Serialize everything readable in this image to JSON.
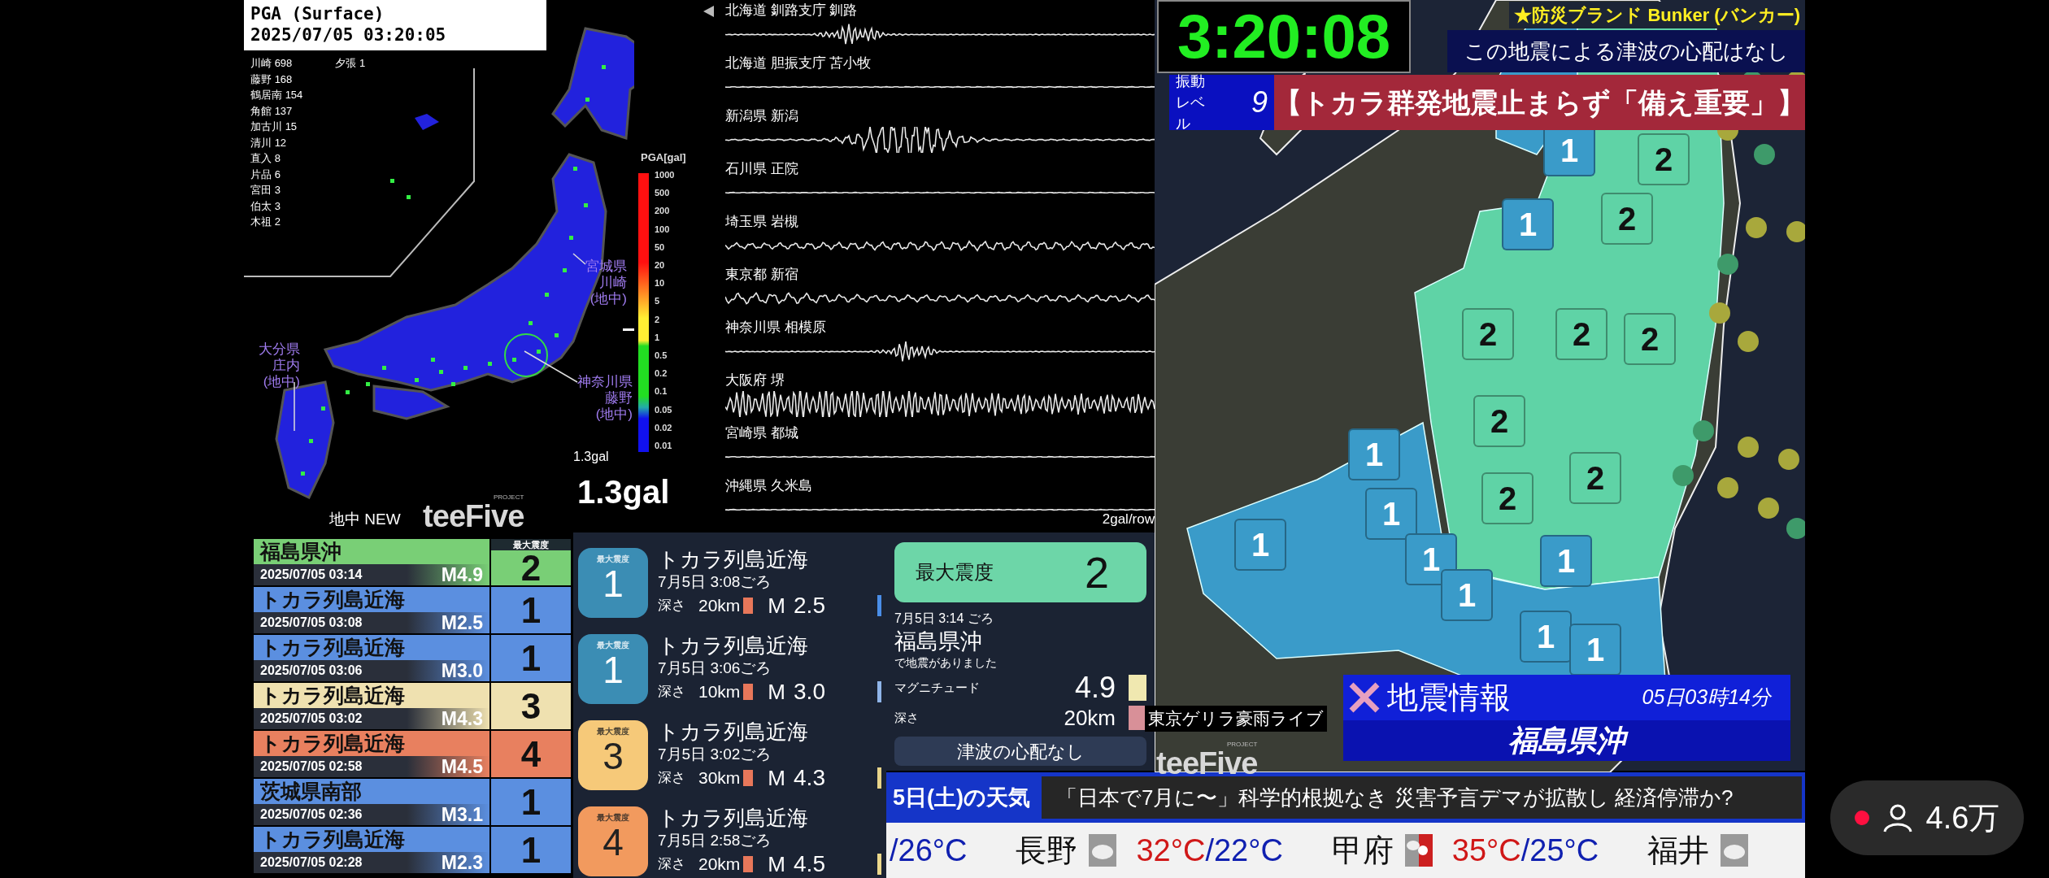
{
  "pga_panel": {
    "title": "PGA (Surface)",
    "timestamp": "2025/07/05 03:20:05",
    "station_columns": [
      [
        {
          "name": "川崎",
          "value": "698"
        },
        {
          "name": "藤野",
          "value": "168"
        },
        {
          "name": "鶴居南",
          "value": "154"
        },
        {
          "name": "角館",
          "value": "137"
        },
        {
          "name": "加古川",
          "value": "15"
        },
        {
          "name": "清川",
          "value": "12"
        },
        {
          "name": "直入",
          "value": "8"
        },
        {
          "name": "片品",
          "value": "6"
        },
        {
          "name": "宮田",
          "value": "3"
        },
        {
          "name": "伯太",
          "value": "3"
        },
        {
          "name": "木祖",
          "value": "2"
        }
      ],
      [
        {
          "name": "夕張",
          "value": "1"
        }
      ]
    ],
    "map_labels": [
      {
        "lines": [
          "宮城県",
          "川崎",
          "(地中)"
        ]
      },
      {
        "lines": [
          "神奈川県",
          "藤野",
          "(地中)"
        ]
      },
      {
        "lines": [
          "大分県",
          "庄内",
          "(地中)"
        ]
      }
    ],
    "legend": {
      "title": "PGA[gal]",
      "ticks": [
        "1000",
        "500",
        "200",
        "100",
        "50",
        "20",
        "10",
        "5",
        "2",
        "1",
        "0.5",
        "0.2",
        "0.1",
        "0.05",
        "0.02",
        "0.01"
      ]
    },
    "marker_value": "1.3gal",
    "big_value": "1.3gal",
    "mode": "地中 NEW",
    "logo": {
      "name": "teeFive",
      "tag": "PROJECT"
    }
  },
  "waveforms": {
    "stations": [
      "北海道 釧路支庁 釧路",
      "北海道 胆振支庁 苫小牧",
      "新潟県 新潟",
      "石川県 正院",
      "埼玉県 岩槻",
      "東京都 新宿",
      "神奈川県 相模原",
      "大阪府 堺",
      "宮崎県 都城",
      "沖縄県 久米島"
    ],
    "scale": "2gal/row"
  },
  "header": {
    "clock": "3:20:08",
    "sponsor": "★防災ブランド Bunker (バンカー)",
    "tsunami": "この地震による津波の心配はなし",
    "vibration": {
      "label_lines": [
        "振動",
        "レベル"
      ],
      "value": "9"
    },
    "headline": "【トカラ群発地震止まらず「備え重要」】"
  },
  "quake_list": {
    "header": "最大震度",
    "rows": [
      {
        "region": "福島県沖",
        "datetime": "2025/07/05 03:14",
        "magnitude": "M4.9",
        "intensity": "2"
      },
      {
        "region": "トカラ列島近海",
        "datetime": "2025/07/05 03:08",
        "magnitude": "M2.5",
        "intensity": "1"
      },
      {
        "region": "トカラ列島近海",
        "datetime": "2025/07/05 03:06",
        "magnitude": "M3.0",
        "intensity": "1"
      },
      {
        "region": "トカラ列島近海",
        "datetime": "2025/07/05 03:02",
        "magnitude": "M4.3",
        "intensity": "3"
      },
      {
        "region": "トカラ列島近海",
        "datetime": "2025/07/05 02:58",
        "magnitude": "M4.5",
        "intensity": "4"
      },
      {
        "region": "茨城県南部",
        "datetime": "2025/07/05 02:36",
        "magnitude": "M3.1",
        "intensity": "1"
      },
      {
        "region": "トカラ列島近海",
        "datetime": "2025/07/05 02:28",
        "magnitude": "M2.3",
        "intensity": "1"
      }
    ]
  },
  "quake_cards": [
    {
      "badge_label": "最大震度",
      "intensity": "1",
      "region": "トカラ列島近海",
      "time": "7月5日 3:08ごろ",
      "depth_label": "深さ",
      "depth": "20km",
      "mag_label": "M",
      "magnitude": "2.5",
      "color": "#4a8ee8"
    },
    {
      "badge_label": "最大震度",
      "intensity": "1",
      "region": "トカラ列島近海",
      "time": "7月5日 3:06ごろ",
      "depth_label": "深さ",
      "depth": "10km",
      "mag_label": "M",
      "magnitude": "3.0",
      "color": "#8fb4e8"
    },
    {
      "badge_label": "最大震度",
      "intensity": "3",
      "region": "トカラ列島近海",
      "time": "7月5日 3:02ごろ",
      "depth_label": "深さ",
      "depth": "30km",
      "mag_label": "M",
      "magnitude": "4.3",
      "color": "#e8d48a"
    },
    {
      "badge_label": "最大震度",
      "intensity": "4",
      "region": "トカラ列島近海",
      "time": "7月5日 2:58ごろ",
      "depth_label": "深さ",
      "depth": "20km",
      "mag_label": "M",
      "magnitude": "4.5",
      "color": "#ecd88c"
    }
  ],
  "latest": {
    "max_label": "最大震度",
    "max_value": "2",
    "time": "7月5日 3:14 ごろ",
    "region": "福島県沖",
    "sentence": "で地震がありました",
    "mag_label": "マグニチュード",
    "magnitude": "4.9",
    "depth_label": "深さ",
    "depth": "20km",
    "tsunami": "津波の心配なし"
  },
  "intensity_map": {
    "markers": [
      {
        "intensity": "1"
      },
      {
        "intensity": "2"
      },
      {
        "intensity": "1"
      },
      {
        "intensity": "2"
      },
      {
        "intensity": "2"
      },
      {
        "intensity": "2"
      },
      {
        "intensity": "2"
      },
      {
        "intensity": "2"
      },
      {
        "intensity": "1"
      },
      {
        "intensity": "2"
      },
      {
        "intensity": "2"
      },
      {
        "intensity": "1"
      },
      {
        "intensity": "1"
      },
      {
        "intensity": "1"
      },
      {
        "intensity": "1"
      },
      {
        "intensity": "1"
      },
      {
        "intensity": "1"
      },
      {
        "intensity": "1"
      }
    ],
    "caption": "東京ゲリラ豪雨ライブ",
    "logo": {
      "name": "teeFive",
      "tag": "PROJECT"
    },
    "alert": {
      "title": "地震情報",
      "time": "05日03時14分",
      "region": "福島県沖"
    }
  },
  "ticker": {
    "weather_title": "5日(土)の天気",
    "news": "「日本で7月に〜」科学的根拠なき 災害予言デマが拡散し 経済停滞か?",
    "temps": [
      {
        "kind": "tail",
        "low": "/26°C"
      },
      {
        "kind": "cloudy",
        "city": "長野",
        "high": "32°C",
        "low": "/22°C"
      },
      {
        "kind": "sunny",
        "city": "甲府",
        "high": "35°C",
        "low": "/25°C"
      },
      {
        "kind": "cloudy",
        "city": "福井"
      }
    ]
  },
  "viewers": {
    "count": "4.6万"
  }
}
